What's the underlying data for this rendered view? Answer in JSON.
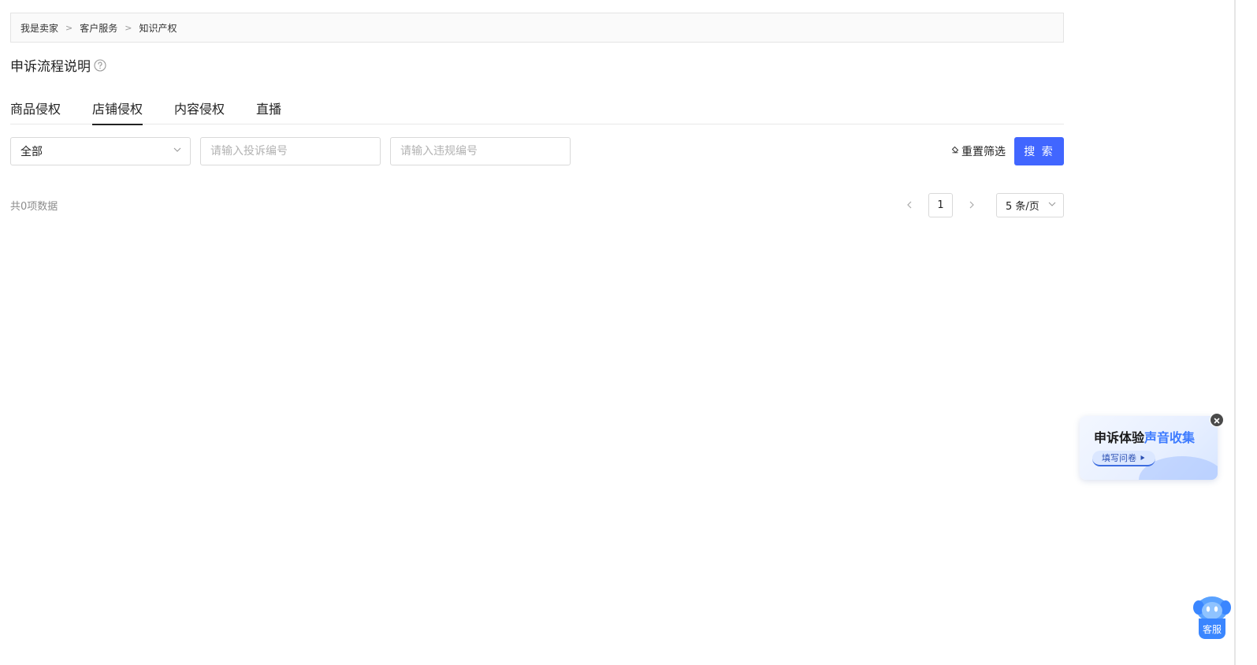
{
  "breadcrumb": {
    "items": [
      {
        "label": "我是卖家"
      },
      {
        "label": "客户服务"
      },
      {
        "label": "知识产权"
      }
    ],
    "separator": ">"
  },
  "header": {
    "title": "申诉流程说明",
    "help_icon": "question-circle-icon"
  },
  "tabs": [
    {
      "label": "商品侵权",
      "active": false
    },
    {
      "label": "店铺侵权",
      "active": true
    },
    {
      "label": "内容侵权",
      "active": false
    },
    {
      "label": "直播",
      "active": false
    }
  ],
  "filters": {
    "type_select_value": "全部",
    "complaint_placeholder": "请输入投诉编号",
    "violation_placeholder": "请输入违规编号",
    "reset_label": "重置筛选",
    "search_label": "搜 索"
  },
  "results": {
    "total_text": "共0项数据"
  },
  "pagination": {
    "current_page": "1",
    "page_size_label": "5 条/页"
  },
  "survey": {
    "title_part1": "申诉体验",
    "title_part2": "声音收集",
    "button_label": "填写问卷"
  },
  "customer_service": {
    "label": "客服"
  },
  "colors": {
    "primary": "#4166ff",
    "survey_accent": "#3d7bff",
    "cs_blue": "#3a86ff"
  }
}
